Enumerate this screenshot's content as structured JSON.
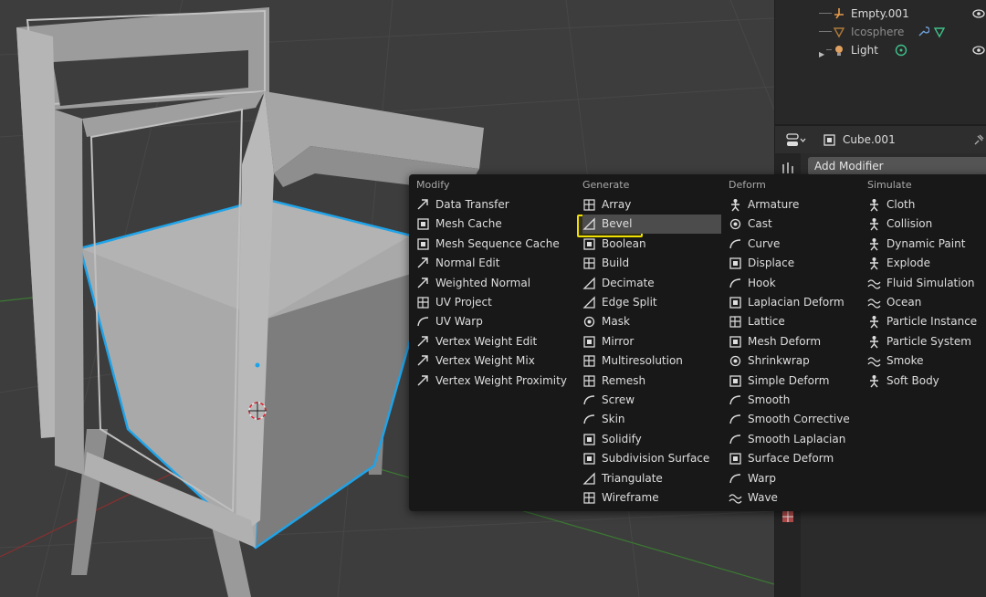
{
  "outliner": {
    "items": [
      {
        "name": "Empty.001",
        "icon": "empty-icon"
      },
      {
        "name": "Icosphere",
        "icon": "mesh-icon"
      },
      {
        "name": "Light",
        "icon": "light-icon"
      }
    ]
  },
  "properties": {
    "object_name": "Cube.001",
    "add_modifier": "Add Modifier"
  },
  "menu": {
    "columns": [
      {
        "title": "Modify",
        "items": [
          "Data Transfer",
          "Mesh Cache",
          "Mesh Sequence Cache",
          "Normal Edit",
          "Weighted Normal",
          "UV Project",
          "UV Warp",
          "Vertex Weight Edit",
          "Vertex Weight Mix",
          "Vertex Weight Proximity"
        ]
      },
      {
        "title": "Generate",
        "items": [
          "Array",
          "Bevel",
          "Boolean",
          "Build",
          "Decimate",
          "Edge Split",
          "Mask",
          "Mirror",
          "Multiresolution",
          "Remesh",
          "Screw",
          "Skin",
          "Solidify",
          "Subdivision Surface",
          "Triangulate",
          "Wireframe"
        ]
      },
      {
        "title": "Deform",
        "items": [
          "Armature",
          "Cast",
          "Curve",
          "Displace",
          "Hook",
          "Laplacian Deform",
          "Lattice",
          "Mesh Deform",
          "Shrinkwrap",
          "Simple Deform",
          "Smooth",
          "Smooth Corrective",
          "Smooth Laplacian",
          "Surface Deform",
          "Warp",
          "Wave"
        ]
      },
      {
        "title": "Simulate",
        "items": [
          "Cloth",
          "Collision",
          "Dynamic Paint",
          "Explode",
          "Fluid Simulation",
          "Ocean",
          "Particle Instance",
          "Particle System",
          "Smoke",
          "Soft Body"
        ]
      }
    ],
    "highlighted": "Bevel"
  },
  "colors": {
    "highlight_outline": "#f0e000",
    "selection_outline": "#1fa3e8",
    "menu_bg": "#181818",
    "viewport_bg": "#3d3d3d"
  }
}
